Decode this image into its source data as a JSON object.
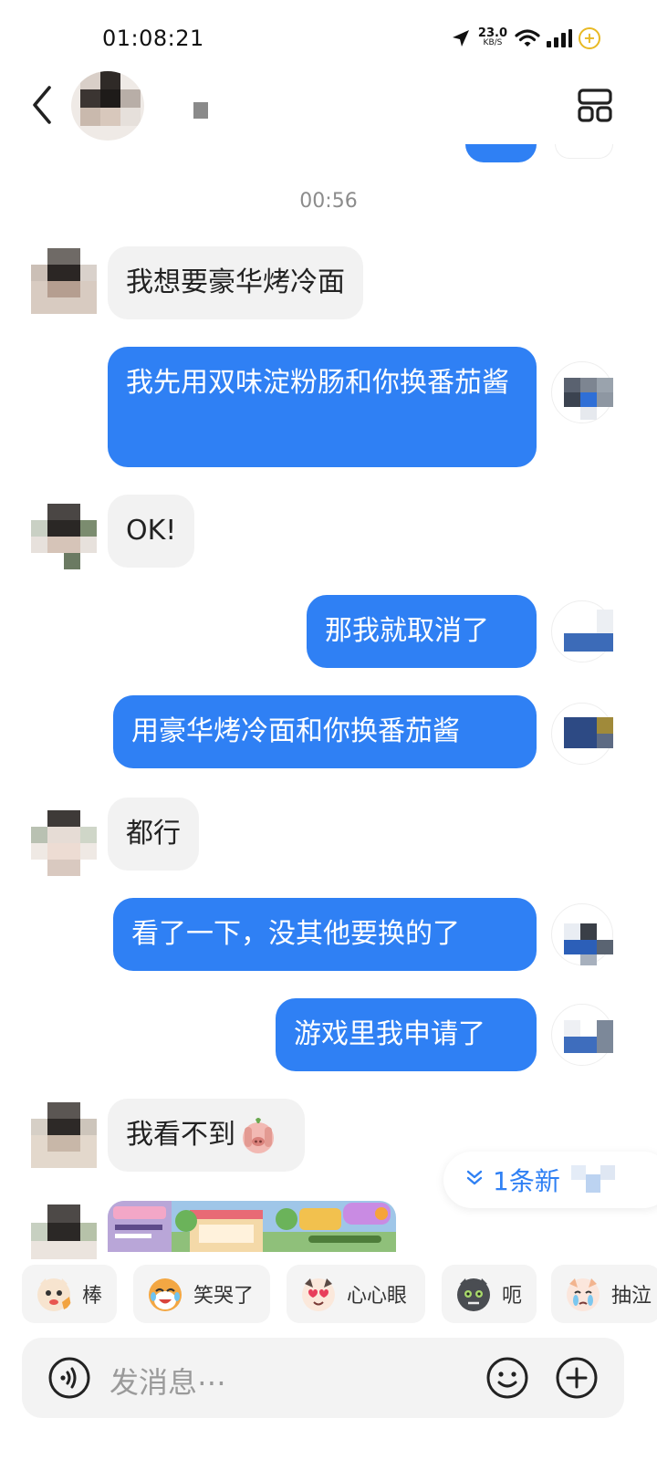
{
  "status_bar": {
    "time": "01:08:21",
    "net_speed_value": "23.0",
    "net_speed_unit": "KB/S",
    "battery_symbol": "+"
  },
  "header": {
    "back_icon": "chevron-left-icon",
    "layout_icon": "grid-layout-icon"
  },
  "chat": {
    "timestamp": "00:56",
    "messages": [
      {
        "side": "in",
        "text": "我想要豪华烤冷面"
      },
      {
        "side": "out",
        "text": "我先用双味淀粉肠和你换番茄酱"
      },
      {
        "side": "in",
        "text": "OK!"
      },
      {
        "side": "out",
        "text": "那我就取消了"
      },
      {
        "side": "out",
        "text": "用豪华烤冷面和你换番茄酱"
      },
      {
        "side": "in",
        "text": "都行"
      },
      {
        "side": "out",
        "text": "看了一下，没其他要换的了"
      },
      {
        "side": "out",
        "text": "游戏里我申请了"
      },
      {
        "side": "in",
        "text": "我看不到"
      }
    ]
  },
  "new_message_pill": {
    "label": "1条新"
  },
  "stickers": [
    {
      "label": "棒"
    },
    {
      "label": "笑哭了"
    },
    {
      "label": "心心眼"
    },
    {
      "label": "呃"
    },
    {
      "label": "抽泣"
    }
  ],
  "input": {
    "placeholder": "发消息⋯"
  },
  "colors": {
    "outgoing_bubble": "#2f80f4",
    "incoming_bubble": "#f2f2f2",
    "accent": "#2f80f4"
  }
}
